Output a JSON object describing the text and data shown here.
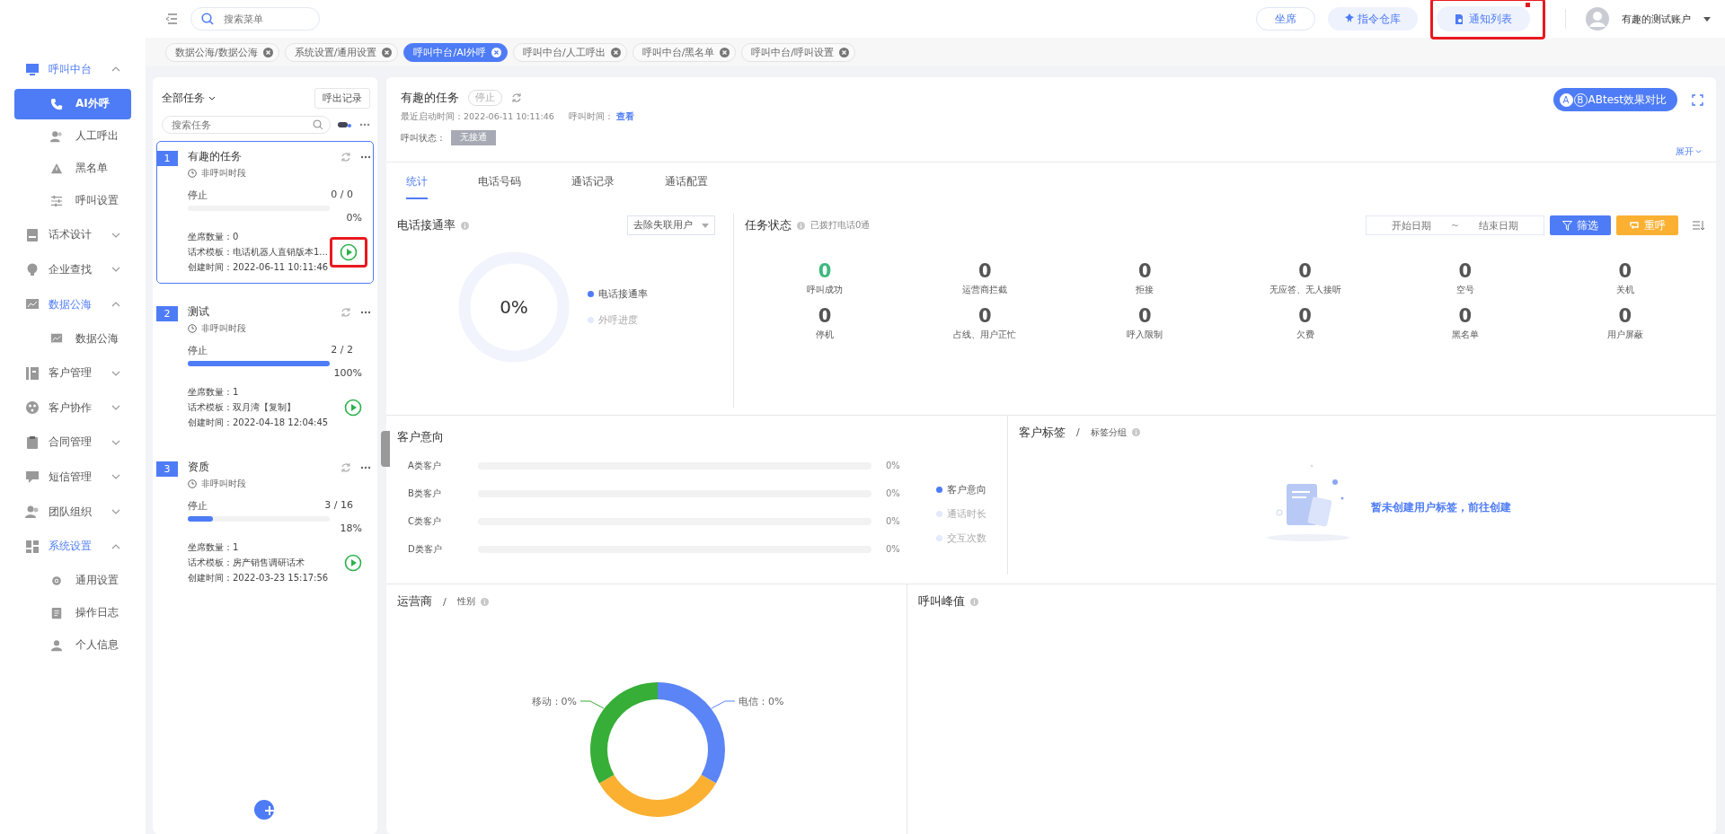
{
  "topbar": {
    "search_placeholder": "搜索菜单",
    "buttons": [
      {
        "label": "坐席",
        "kind": "outline"
      },
      {
        "label": "指令仓库",
        "kind": "pin"
      },
      {
        "label": "通知列表",
        "kind": "doc",
        "badge": true,
        "highlighted": true
      }
    ],
    "user": "有趣的测试账户"
  },
  "sidebar": {
    "items": [
      {
        "label": "呼叫中台",
        "expanded": true,
        "children": [
          {
            "label": "AI外呼",
            "selected": true
          },
          {
            "label": "人工呼出",
            "selected": false
          },
          {
            "label": "黑名单",
            "selected": false
          },
          {
            "label": "呼叫设置",
            "selected": false
          }
        ]
      },
      {
        "label": "话术设计",
        "expanded": false
      },
      {
        "label": "企业查找",
        "expanded": false
      },
      {
        "label": "数据公海",
        "expanded": true,
        "children": [
          {
            "label": "数据公海",
            "selected": false
          }
        ]
      },
      {
        "label": "客户管理",
        "expanded": false
      },
      {
        "label": "客户协作",
        "expanded": false
      },
      {
        "label": "合同管理",
        "expanded": false
      },
      {
        "label": "短信管理",
        "expanded": false
      },
      {
        "label": "团队组织",
        "expanded": false
      },
      {
        "label": "系统设置",
        "expanded": true,
        "children": [
          {
            "label": "通用设置",
            "selected": false
          },
          {
            "label": "操作日志",
            "selected": false
          },
          {
            "label": "个人信息",
            "selected": false
          }
        ]
      }
    ]
  },
  "page_tabs": [
    {
      "label": "数据公海/数据公海",
      "selected": false
    },
    {
      "label": "系统设置/通用设置",
      "selected": false
    },
    {
      "label": "呼叫中台/AI外呼",
      "selected": true
    },
    {
      "label": "呼叫中台/人工呼出",
      "selected": false
    },
    {
      "label": "呼叫中台/黑名单",
      "selected": false
    },
    {
      "label": "呼叫中台/呼叫设置",
      "selected": false
    }
  ],
  "task_list": {
    "filter": "全部任务",
    "records_button": "呼出记录",
    "search_placeholder": "搜索任务",
    "tasks": [
      {
        "index": "1",
        "name": "有趣的任务",
        "schedule": "非呼叫时段",
        "status": "停止",
        "count": "0 / 0",
        "level": 0,
        "percent": "0%",
        "details": [
          "坐席数量：0",
          "话术模板：电话机器人直销版本1...",
          "创建时间：2022-06-11 10:11:46"
        ],
        "selected": true,
        "highlighted": true
      },
      {
        "index": "2",
        "name": "测试",
        "schedule": "非呼叫时段",
        "status": "停止",
        "count": "2 / 2",
        "level": 1,
        "percent": "100%",
        "details": [
          "坐席数量：1",
          "话术模板：双月湾【复制】",
          "创建时间：2022-04-18 12:04:45"
        ],
        "selected": false
      },
      {
        "index": "3",
        "name": "资质",
        "schedule": "非呼叫时段",
        "status": "停止",
        "count": "3 / 16",
        "level": 0.18,
        "percent": "18%",
        "details": [
          "坐席数量：1",
          "话术模板：房产销售调研话术",
          "创建时间：2022-03-23 15:17:56"
        ],
        "selected": false
      }
    ]
  },
  "detail": {
    "title": "有趣的任务",
    "status": "停止",
    "last_start": "最近启动时间：2022-06-11 10:11:46",
    "call_time_label": "呼叫时间：",
    "call_time_link": "查看",
    "call_state_label": "呼叫状态：",
    "call_state": "无接通",
    "ab_letters": [
      "A",
      "B"
    ],
    "ab_button": "ABtest效果对比",
    "expand": "展开",
    "tabs": [
      {
        "label": "统计",
        "selected": true
      },
      {
        "label": "电话号码",
        "selected": false
      },
      {
        "label": "通话记录",
        "selected": false
      },
      {
        "label": "通话配置",
        "selected": false
      }
    ]
  },
  "connect_rate": {
    "title": "电话接通率",
    "select": "去除失联用户",
    "center": "0%",
    "legend": [
      {
        "label": "电话接通率",
        "color": "#4e7cf6"
      },
      {
        "label": "外呼进度",
        "color": "#e3eafc"
      }
    ]
  },
  "task_status": {
    "title": "任务状态",
    "subtitle": "已拨打电话0通",
    "start_placeholder": "开始日期",
    "separator": "~",
    "end_placeholder": "结束日期",
    "filter_button": "筛选",
    "recall_button": "重呼",
    "stats": [
      {
        "value": "0",
        "label": "呼叫成功",
        "color": "#3dba7e"
      },
      {
        "value": "0",
        "label": "运营商拦截",
        "color": "#555555"
      },
      {
        "value": "0",
        "label": "拒接",
        "color": "#555555"
      },
      {
        "value": "0",
        "label": "无应答、无人接听",
        "color": "#555555"
      },
      {
        "value": "0",
        "label": "空号",
        "color": "#555555"
      },
      {
        "value": "0",
        "label": "关机",
        "color": "#555555"
      },
      {
        "value": "0",
        "label": "停机",
        "color": "#555555"
      },
      {
        "value": "0",
        "label": "占线、用户正忙",
        "color": "#555555"
      },
      {
        "value": "0",
        "label": "呼入限制",
        "color": "#555555"
      },
      {
        "value": "0",
        "label": "欠费",
        "color": "#555555"
      },
      {
        "value": "0",
        "label": "黑名单",
        "color": "#555555"
      },
      {
        "value": "0",
        "label": "用户屏蔽",
        "color": "#555555"
      }
    ]
  },
  "intent": {
    "title": "客户意向",
    "rows": [
      {
        "label": "A类客户",
        "level": 0,
        "percent": "0%"
      },
      {
        "label": "B类客户",
        "level": 0,
        "percent": "0%"
      },
      {
        "label": "C类客户",
        "level": 0,
        "percent": "0%"
      },
      {
        "label": "D类客户",
        "level": 0,
        "percent": "0%"
      }
    ],
    "legend": [
      {
        "label": "客户意向",
        "color": "#4e7cf6"
      },
      {
        "label": "通话时长",
        "color": "#e3eafc"
      },
      {
        "label": "交互次数",
        "color": "#e3eafc"
      }
    ]
  },
  "tags": {
    "title": "客户标签",
    "separator": "/",
    "subtitle": "标签分组",
    "empty_text": "暂未创建用户标签，前往创建"
  },
  "carrier": {
    "title": "运营商",
    "separator": "/",
    "subtitle": "性别",
    "slice_labels": [
      "移动：0%",
      "电信：0%"
    ]
  },
  "peak": {
    "title": "呼叫峰值"
  }
}
